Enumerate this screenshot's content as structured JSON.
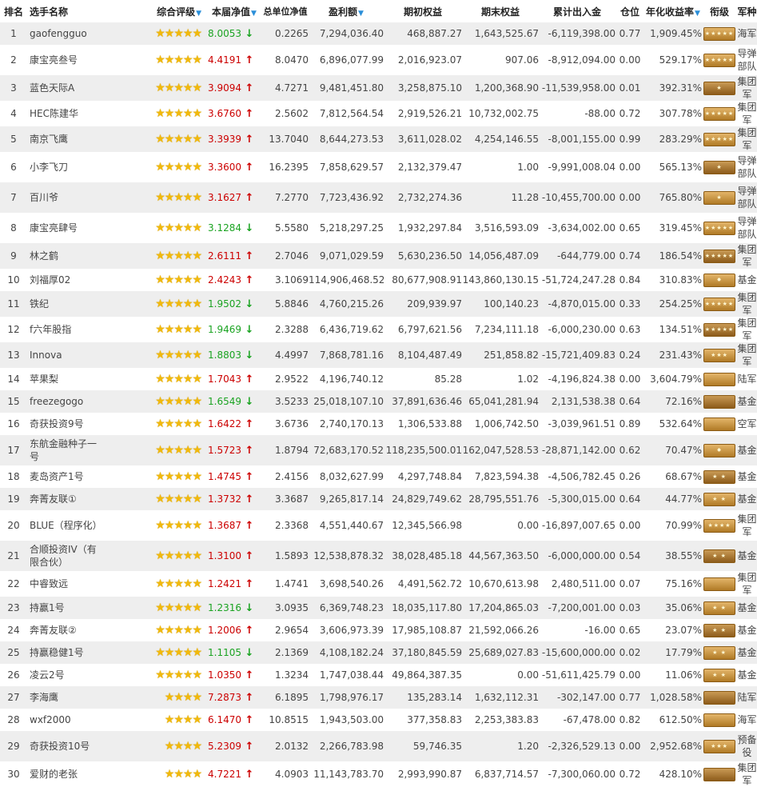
{
  "headers": {
    "rank": "排名",
    "name": "选手名称",
    "rating": "综合评级",
    "nav": "本届净值",
    "total_nav": "总单位净值",
    "profit": "盈利额",
    "start_equity": "期初权益",
    "end_equity": "期末权益",
    "cum_inout": "累计出入金",
    "position": "仓位",
    "annual": "年化收益率",
    "grade": "衔级",
    "army": "军种"
  },
  "colors": {
    "up": "#cc0000",
    "down": "#1aa321",
    "star": "#f2b90a",
    "sort": "#2b8fd9"
  },
  "icons": {
    "star": "star-icon",
    "up": "arrow-up-icon",
    "down": "arrow-down-icon",
    "sort": "sort-down-icon",
    "badge": "rank-insignia-icon"
  },
  "rows": [
    {
      "rank": "1",
      "name": "gaofengguo",
      "stars": 5,
      "nav": "8.0053",
      "dir": "down",
      "total_nav": "0.2265",
      "profit": "7,294,036.40",
      "start": "468,887.27",
      "end": "1,643,525.67",
      "inout": "-6,119,398.00",
      "pos": "0.77",
      "annual": "1,909.45%",
      "badge": "★★★★★",
      "army": "海军"
    },
    {
      "rank": "2",
      "name": "康宝亮叁号",
      "stars": 5,
      "nav": "4.4191",
      "dir": "up",
      "total_nav": "8.0470",
      "profit": "6,896,077.99",
      "start": "2,016,923.07",
      "end": "907.06",
      "inout": "-8,912,094.00",
      "pos": "0.00",
      "annual": "529.17%",
      "badge": "★★★★★",
      "army": "导弹部队"
    },
    {
      "rank": "3",
      "name": "蓝色天际A",
      "stars": 5,
      "nav": "3.9094",
      "dir": "up",
      "total_nav": "4.7271",
      "profit": "9,481,451.80",
      "start": "3,258,875.10",
      "end": "1,200,368.90",
      "inout": "-11,539,958.00",
      "pos": "0.01",
      "annual": "392.31%",
      "badge": "★",
      "army": "集团军"
    },
    {
      "rank": "4",
      "name": "HEC陈建华",
      "stars": 5,
      "nav": "3.6760",
      "dir": "up",
      "total_nav": "2.5602",
      "profit": "7,812,564.54",
      "start": "2,919,526.21",
      "end": "10,732,002.75",
      "inout": "-88.00",
      "pos": "0.72",
      "annual": "307.78%",
      "badge": "★★★★★",
      "army": "集团军"
    },
    {
      "rank": "5",
      "name": "南京飞鹰",
      "stars": 5,
      "nav": "3.3939",
      "dir": "up",
      "total_nav": "13.7040",
      "profit": "8,644,273.53",
      "start": "3,611,028.02",
      "end": "4,254,146.55",
      "inout": "-8,001,155.00",
      "pos": "0.99",
      "annual": "283.29%",
      "badge": "★★★★★",
      "army": "集团军"
    },
    {
      "rank": "6",
      "name": "小李飞刀",
      "stars": 5,
      "nav": "3.3600",
      "dir": "up",
      "total_nav": "16.2395",
      "profit": "7,858,629.57",
      "start": "2,132,379.47",
      "end": "1.00",
      "inout": "-9,991,008.04",
      "pos": "0.00",
      "annual": "565.13%",
      "badge": "★",
      "army": "导弹部队"
    },
    {
      "rank": "7",
      "name": "百川爷",
      "stars": 5,
      "nav": "3.1627",
      "dir": "up",
      "total_nav": "7.2770",
      "profit": "7,723,436.92",
      "start": "2,732,274.36",
      "end": "11.28",
      "inout": "-10,455,700.00",
      "pos": "0.00",
      "annual": "765.80%",
      "badge": "★",
      "army": "导弹部队"
    },
    {
      "rank": "8",
      "name": "康宝亮肆号",
      "stars": 5,
      "nav": "3.1284",
      "dir": "down",
      "total_nav": "5.5580",
      "profit": "5,218,297.25",
      "start": "1,932,297.84",
      "end": "3,516,593.09",
      "inout": "-3,634,002.00",
      "pos": "0.65",
      "annual": "319.45%",
      "badge": "★★★★★",
      "army": "导弹部队"
    },
    {
      "rank": "9",
      "name": "林之鹤",
      "stars": 5,
      "nav": "2.6111",
      "dir": "up",
      "total_nav": "2.7046",
      "profit": "9,071,029.59",
      "start": "5,630,236.50",
      "end": "14,056,487.09",
      "inout": "-644,779.00",
      "pos": "0.74",
      "annual": "186.54%",
      "badge": "★★★★★",
      "army": "集团军"
    },
    {
      "rank": "10",
      "name": "刘福厚02",
      "stars": 5,
      "nav": "2.4243",
      "dir": "up",
      "total_nav": "3.1069",
      "profit": "114,906,468.52",
      "start": "80,677,908.91",
      "end": "143,860,130.15",
      "inout": "-51,724,247.28",
      "pos": "0.84",
      "annual": "310.83%",
      "badge": "✸",
      "army": "基金"
    },
    {
      "rank": "11",
      "name": "铁纪",
      "stars": 5,
      "nav": "1.9502",
      "dir": "down",
      "total_nav": "5.8846",
      "profit": "4,760,215.26",
      "start": "209,939.97",
      "end": "100,140.23",
      "inout": "-4,870,015.00",
      "pos": "0.33",
      "annual": "254.25%",
      "badge": "★★★★★",
      "army": "集团军"
    },
    {
      "rank": "12",
      "name": "f六年股指",
      "stars": 5,
      "nav": "1.9469",
      "dir": "down",
      "total_nav": "2.3288",
      "profit": "6,436,719.62",
      "start": "6,797,621.56",
      "end": "7,234,111.18",
      "inout": "-6,000,230.00",
      "pos": "0.63",
      "annual": "134.51%",
      "badge": "★★★★★",
      "army": "集团军"
    },
    {
      "rank": "13",
      "name": "Innova",
      "stars": 5,
      "nav": "1.8803",
      "dir": "down",
      "total_nav": "4.4997",
      "profit": "7,868,781.16",
      "start": "8,104,487.49",
      "end": "251,858.82",
      "inout": "-15,721,409.83",
      "pos": "0.24",
      "annual": "231.43%",
      "badge": "★★★",
      "army": "集团军"
    },
    {
      "rank": "14",
      "name": "苹果梨",
      "stars": 5,
      "nav": "1.7043",
      "dir": "up",
      "total_nav": "2.9522",
      "profit": "4,196,740.12",
      "start": "85.28",
      "end": "1.02",
      "inout": "-4,196,824.38",
      "pos": "0.00",
      "annual": "3,604.79%",
      "badge": "",
      "army": "陆军"
    },
    {
      "rank": "15",
      "name": "freezegogo",
      "stars": 5,
      "nav": "1.6549",
      "dir": "down",
      "total_nav": "3.5233",
      "profit": "25,018,107.10",
      "start": "37,891,636.46",
      "end": "65,041,281.94",
      "inout": "2,131,538.38",
      "pos": "0.64",
      "annual": "72.16%",
      "badge": "",
      "army": "基金"
    },
    {
      "rank": "16",
      "name": "奇获投资9号",
      "stars": 5,
      "nav": "1.6422",
      "dir": "up",
      "total_nav": "3.6736",
      "profit": "2,740,170.13",
      "start": "1,306,533.88",
      "end": "1,006,742.50",
      "inout": "-3,039,961.51",
      "pos": "0.89",
      "annual": "532.64%",
      "badge": "",
      "army": "空军"
    },
    {
      "rank": "17",
      "name": "东航金融种子一号",
      "stars": 5,
      "nav": "1.5723",
      "dir": "up",
      "total_nav": "1.8794",
      "profit": "72,683,170.52",
      "start": "118,235,500.01",
      "end": "162,047,528.53",
      "inout": "-28,871,142.00",
      "pos": "0.62",
      "annual": "70.47%",
      "badge": "✸",
      "army": "基金"
    },
    {
      "rank": "18",
      "name": "麦岛资产1号",
      "stars": 5,
      "nav": "1.4745",
      "dir": "up",
      "total_nav": "2.4156",
      "profit": "8,032,627.99",
      "start": "4,297,748.84",
      "end": "7,823,594.38",
      "inout": "-4,506,782.45",
      "pos": "0.26",
      "annual": "68.67%",
      "badge": "★ ★",
      "army": "基金"
    },
    {
      "rank": "19",
      "name": "奔菁友联①",
      "stars": 5,
      "nav": "1.3732",
      "dir": "up",
      "total_nav": "3.3687",
      "profit": "9,265,817.14",
      "start": "24,829,749.62",
      "end": "28,795,551.76",
      "inout": "-5,300,015.00",
      "pos": "0.64",
      "annual": "44.77%",
      "badge": "★ ★",
      "army": "基金"
    },
    {
      "rank": "20",
      "name": "BLUE（程序化）",
      "stars": 5,
      "nav": "1.3687",
      "dir": "up",
      "total_nav": "2.3368",
      "profit": "4,551,440.67",
      "start": "12,345,566.98",
      "end": "0.00",
      "inout": "-16,897,007.65",
      "pos": "0.00",
      "annual": "70.99%",
      "badge": "★★★★",
      "army": "集团军"
    },
    {
      "rank": "21",
      "name": "合顺投资IV（有限合伙）",
      "stars": 5,
      "nav": "1.3100",
      "dir": "up",
      "total_nav": "1.5893",
      "profit": "12,538,878.32",
      "start": "38,028,485.18",
      "end": "44,567,363.50",
      "inout": "-6,000,000.00",
      "pos": "0.54",
      "annual": "38.55%",
      "badge": "★ ★",
      "army": "基金"
    },
    {
      "rank": "22",
      "name": "中睿致远",
      "stars": 5,
      "nav": "1.2421",
      "dir": "up",
      "total_nav": "1.4741",
      "profit": "3,698,540.26",
      "start": "4,491,562.72",
      "end": "10,670,613.98",
      "inout": "2,480,511.00",
      "pos": "0.07",
      "annual": "75.16%",
      "badge": "",
      "army": "集团军"
    },
    {
      "rank": "23",
      "name": "持赢1号",
      "stars": 5,
      "nav": "1.2316",
      "dir": "down",
      "total_nav": "3.0935",
      "profit": "6,369,748.23",
      "start": "18,035,117.80",
      "end": "17,204,865.03",
      "inout": "-7,200,001.00",
      "pos": "0.03",
      "annual": "35.06%",
      "badge": "★ ★",
      "army": "基金"
    },
    {
      "rank": "24",
      "name": "奔菁友联②",
      "stars": 5,
      "nav": "1.2006",
      "dir": "up",
      "total_nav": "2.9654",
      "profit": "3,606,973.39",
      "start": "17,985,108.87",
      "end": "21,592,066.26",
      "inout": "-16.00",
      "pos": "0.65",
      "annual": "23.07%",
      "badge": "★ ★",
      "army": "基金"
    },
    {
      "rank": "25",
      "name": "持赢稳健1号",
      "stars": 5,
      "nav": "1.1105",
      "dir": "down",
      "total_nav": "2.1369",
      "profit": "4,108,182.24",
      "start": "37,180,845.59",
      "end": "25,689,027.83",
      "inout": "-15,600,000.00",
      "pos": "0.02",
      "annual": "17.79%",
      "badge": "★ ★",
      "army": "基金"
    },
    {
      "rank": "26",
      "name": "凌云2号",
      "stars": 5,
      "nav": "1.0350",
      "dir": "up",
      "total_nav": "1.3234",
      "profit": "1,747,038.44",
      "start": "49,864,387.35",
      "end": "0.00",
      "inout": "-51,611,425.79",
      "pos": "0.00",
      "annual": "11.06%",
      "badge": "★ ★",
      "army": "基金"
    },
    {
      "rank": "27",
      "name": "李海鹰",
      "stars": 4,
      "nav": "7.2873",
      "dir": "up",
      "total_nav": "6.1895",
      "profit": "1,798,976.17",
      "start": "135,283.14",
      "end": "1,632,112.31",
      "inout": "-302,147.00",
      "pos": "0.77",
      "annual": "1,028.58%",
      "badge": "",
      "army": "陆军"
    },
    {
      "rank": "28",
      "name": "wxf2000",
      "stars": 4,
      "nav": "6.1470",
      "dir": "up",
      "total_nav": "10.8515",
      "profit": "1,943,503.00",
      "start": "377,358.83",
      "end": "2,253,383.83",
      "inout": "-67,478.00",
      "pos": "0.82",
      "annual": "612.50%",
      "badge": "",
      "army": "海军"
    },
    {
      "rank": "29",
      "name": "奇获投资10号",
      "stars": 4,
      "nav": "5.2309",
      "dir": "up",
      "total_nav": "2.0132",
      "profit": "2,266,783.98",
      "start": "59,746.35",
      "end": "1.20",
      "inout": "-2,326,529.13",
      "pos": "0.00",
      "annual": "2,952.68%",
      "badge": "★★★",
      "army": "预备役"
    },
    {
      "rank": "30",
      "name": "爱财的老张",
      "stars": 4,
      "nav": "4.7221",
      "dir": "up",
      "total_nav": "4.0903",
      "profit": "11,143,783.70",
      "start": "2,993,990.87",
      "end": "6,837,714.57",
      "inout": "-7,300,060.00",
      "pos": "0.72",
      "annual": "428.10%",
      "badge": "",
      "army": "集团军"
    }
  ]
}
